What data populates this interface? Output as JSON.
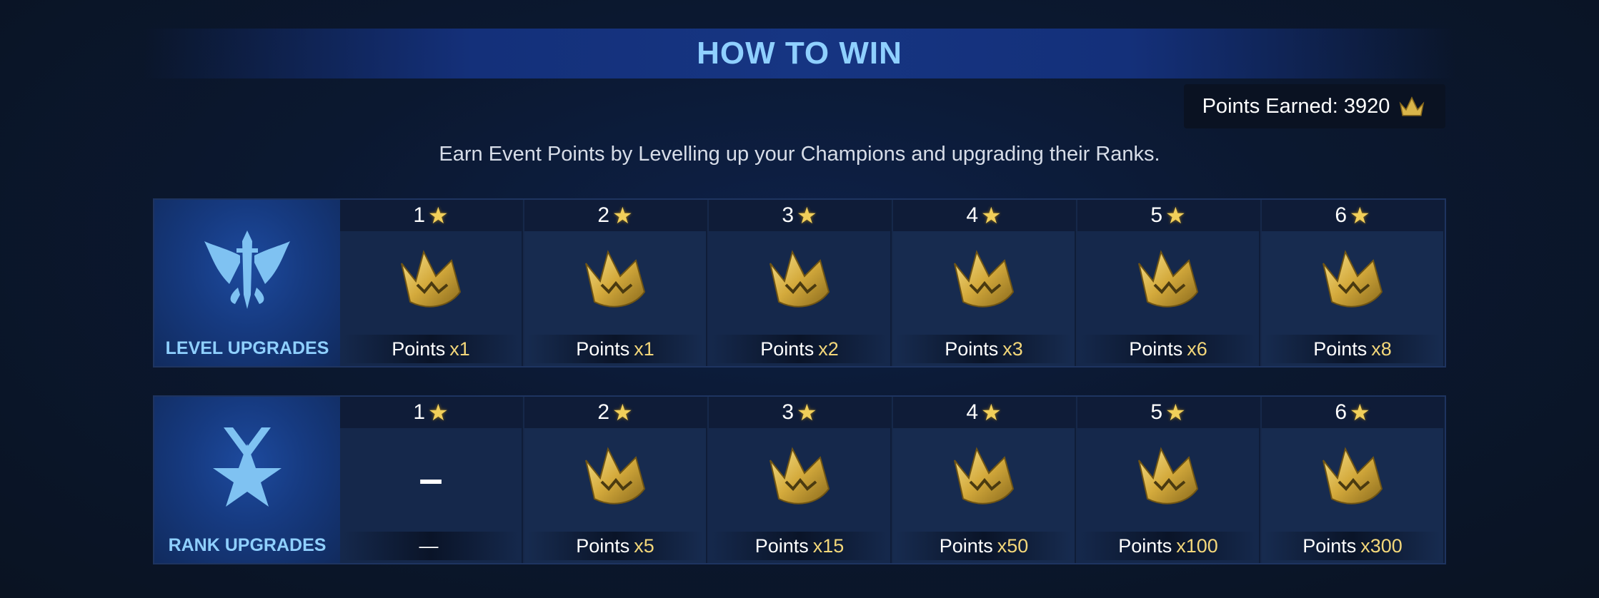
{
  "title": "HOW TO WIN",
  "points_earned": {
    "label": "Points Earned: 3920",
    "icon": "crown-icon"
  },
  "subtitle": "Earn Event Points by Levelling up your Champions and upgrading their Ranks.",
  "colors": {
    "title": "#8fd0ff",
    "multiplier": "#f3d77a",
    "star": "#f1cf5a",
    "crown": "#d9b54a"
  },
  "level_upgrades": {
    "label": "LEVEL UPGRADES",
    "emblem": "winged-sword-icon",
    "tiers": [
      {
        "stars": "1",
        "points_label": "Points",
        "multiplier": "x1"
      },
      {
        "stars": "2",
        "points_label": "Points",
        "multiplier": "x1"
      },
      {
        "stars": "3",
        "points_label": "Points",
        "multiplier": "x2"
      },
      {
        "stars": "4",
        "points_label": "Points",
        "multiplier": "x3"
      },
      {
        "stars": "5",
        "points_label": "Points",
        "multiplier": "x6"
      },
      {
        "stars": "6",
        "points_label": "Points",
        "multiplier": "x8"
      }
    ]
  },
  "rank_upgrades": {
    "label": "RANK UPGRADES",
    "emblem": "star-medal-icon",
    "tiers": [
      {
        "stars": "1",
        "points_label": "—",
        "multiplier": "",
        "dash": "–"
      },
      {
        "stars": "2",
        "points_label": "Points",
        "multiplier": "x5"
      },
      {
        "stars": "3",
        "points_label": "Points",
        "multiplier": "x15"
      },
      {
        "stars": "4",
        "points_label": "Points",
        "multiplier": "x50"
      },
      {
        "stars": "5",
        "points_label": "Points",
        "multiplier": "x100"
      },
      {
        "stars": "6",
        "points_label": "Points",
        "multiplier": "x300"
      }
    ]
  }
}
